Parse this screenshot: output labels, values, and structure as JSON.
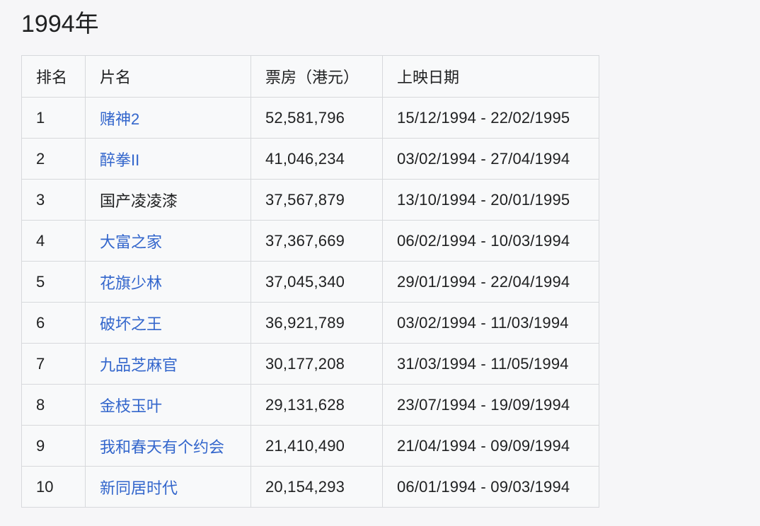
{
  "title": "1994年",
  "table": {
    "headers": [
      "排名",
      "片名",
      "票房（港元）",
      "上映日期"
    ],
    "rows": [
      {
        "rank": "1",
        "name": "赌神2",
        "link": true,
        "box": "52,581,796",
        "date": "15/12/1994 - 22/02/1995"
      },
      {
        "rank": "2",
        "name": "醉拳II",
        "link": true,
        "box": "41,046,234",
        "date": "03/02/1994 - 27/04/1994"
      },
      {
        "rank": "3",
        "name": "国产凌凌漆",
        "link": false,
        "box": "37,567,879",
        "date": "13/10/1994 - 20/01/1995"
      },
      {
        "rank": "4",
        "name": "大富之家",
        "link": true,
        "box": "37,367,669",
        "date": "06/02/1994 - 10/03/1994"
      },
      {
        "rank": "5",
        "name": "花旗少林",
        "link": true,
        "box": "37,045,340",
        "date": "29/01/1994 - 22/04/1994"
      },
      {
        "rank": "6",
        "name": "破坏之王",
        "link": true,
        "box": "36,921,789",
        "date": "03/02/1994 - 11/03/1994"
      },
      {
        "rank": "7",
        "name": "九品芝麻官",
        "link": true,
        "box": "30,177,208",
        "date": "31/03/1994 - 11/05/1994"
      },
      {
        "rank": "8",
        "name": "金枝玉叶",
        "link": true,
        "box": "29,131,628",
        "date": "23/07/1994 - 19/09/1994"
      },
      {
        "rank": "9",
        "name": "我和春天有个约会",
        "link": true,
        "box": "21,410,490",
        "date": "21/04/1994 - 09/09/1994"
      },
      {
        "rank": "10",
        "name": "新同居时代",
        "link": true,
        "box": "20,154,293",
        "date": "06/01/1994 - 09/03/1994"
      }
    ]
  },
  "colors": {
    "link": "#3366cc",
    "text": "#202122",
    "border": "#d7d9dc",
    "table_bg": "#f8f9fa"
  }
}
